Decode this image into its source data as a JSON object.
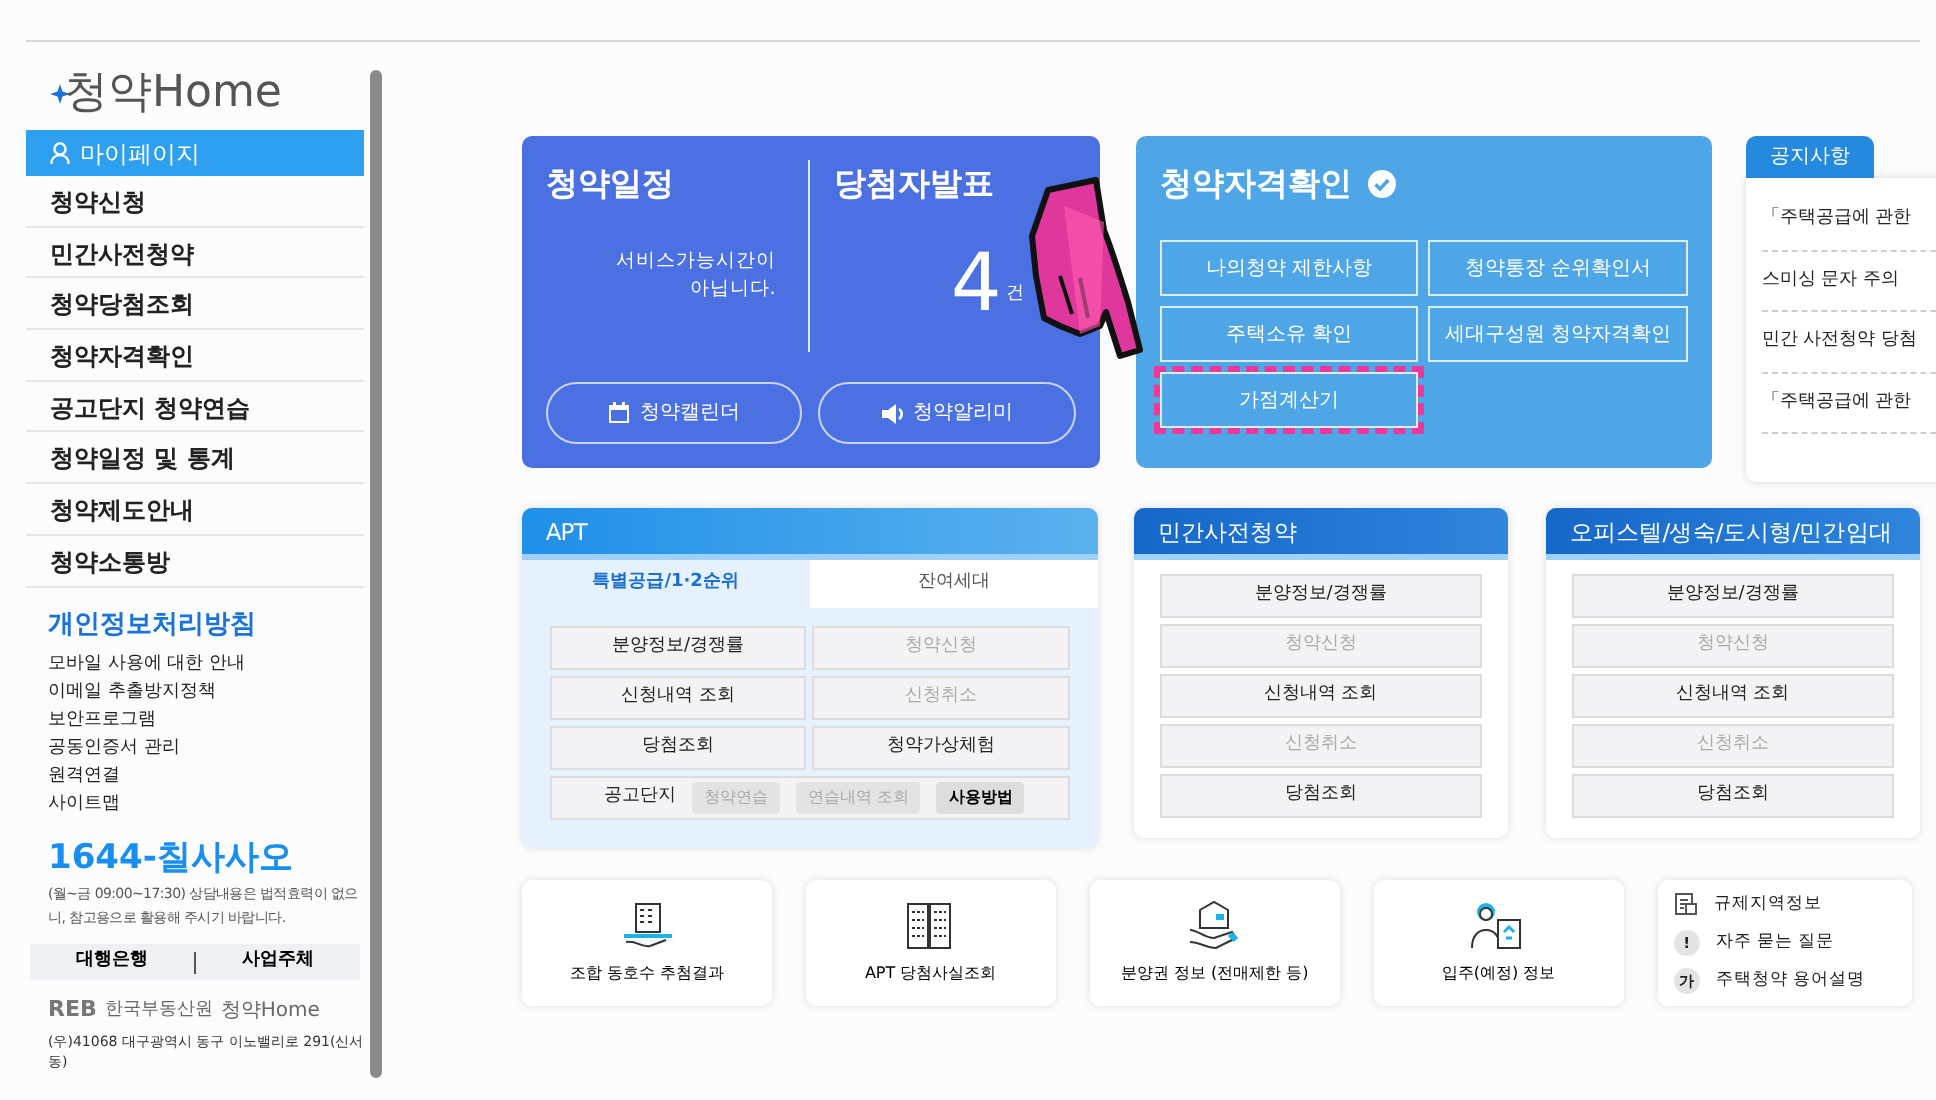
{
  "sidebar": {
    "logo": "청약Home",
    "items": [
      {
        "label": "마이페이지",
        "selected": true,
        "kind": "user"
      },
      {
        "label": "청약신청",
        "selected": false
      },
      {
        "label": "민간사전청약",
        "selected": false
      },
      {
        "label": "청약당첨조회",
        "selected": false
      },
      {
        "label": "청약자격확인",
        "selected": false
      },
      {
        "label": "공고단지 청약연습",
        "selected": false
      },
      {
        "label": "청약일정 및 통계",
        "selected": false
      },
      {
        "label": "청약제도안내",
        "selected": false
      },
      {
        "label": "청약소통방",
        "selected": false
      }
    ],
    "policy_title": "개인정보처리방침",
    "links": [
      "모바일 사용에 대한 안내",
      "이메일 추출방지정책",
      "보안프로그램",
      "공동인증서 관리",
      "원격연결",
      "사이트맵"
    ],
    "phone": "1644-칠사사오",
    "hours_note": "(월~금 09:00~17:30) 상담내용은 법적효력이 없으니, 참고용으로 활용해 주시기 바랍니다.",
    "footer_buttons": [
      "대행은행",
      "사업주체"
    ],
    "footer_logo": {
      "mark": "REB",
      "org": "한국부동산원",
      "site": "청약Home"
    },
    "address": "(우)41068 대구광역시 동구 이노밸리로 291(신서동)"
  },
  "schedule_card": {
    "title": "청약일정",
    "message": "서비스가능시간이 아닙니다.",
    "winners_title": "당첨자발표",
    "count": "4",
    "unit": "건",
    "buttons": [
      {
        "label": "청약캘린더",
        "kind": "calendar"
      },
      {
        "label": "청약알리미",
        "kind": "speaker"
      }
    ]
  },
  "eligibility_card": {
    "title": "청약자격확인",
    "buttons": [
      {
        "label": "나의청약 제한사항",
        "highlighted": false
      },
      {
        "label": "청약통장 순위확인서",
        "highlighted": false
      },
      {
        "label": "주택소유 확인",
        "highlighted": false
      },
      {
        "label": "세대구성원 청약자격확인",
        "highlighted": false
      },
      {
        "label": "가점계산기",
        "highlighted": true
      }
    ]
  },
  "notice": {
    "title": "공지사항",
    "items": [
      "「주택공급에 관한",
      "스미싱 문자 주의",
      "민간 사전청약 당첨",
      "「주택공급에 관한"
    ]
  },
  "apt_panel": {
    "title": "APT",
    "tabs": [
      {
        "label": "특별공급/1·2순위",
        "selected": true
      },
      {
        "label": "잔여세대",
        "selected": false
      }
    ],
    "buttons": [
      {
        "label": "분양정보/경쟁률",
        "disabled": false
      },
      {
        "label": "청약신청",
        "disabled": true
      },
      {
        "label": "신청내역 조회",
        "disabled": false
      },
      {
        "label": "신청취소",
        "disabled": true
      },
      {
        "label": "당첨조회",
        "disabled": false
      },
      {
        "label": "청약가상체험",
        "disabled": false
      }
    ],
    "practice_label": "공고단지",
    "practice_buttons": [
      {
        "label": "청약연습",
        "disabled": true
      },
      {
        "label": "연습내역 조회",
        "disabled": true
      },
      {
        "label": "사용방법",
        "disabled": false
      }
    ]
  },
  "side_panels": [
    {
      "title": "민간사전청약",
      "buttons": [
        {
          "label": "분양정보/경쟁률",
          "disabled": false
        },
        {
          "label": "청약신청",
          "disabled": true
        },
        {
          "label": "신청내역 조회",
          "disabled": false
        },
        {
          "label": "신청취소",
          "disabled": true
        },
        {
          "label": "당첨조회",
          "disabled": false
        }
      ]
    },
    {
      "title": "오피스텔/생숙/도시형/민간임대",
      "buttons": [
        {
          "label": "분양정보/경쟁률",
          "disabled": false
        },
        {
          "label": "청약신청",
          "disabled": true
        },
        {
          "label": "신청내역 조회",
          "disabled": false
        },
        {
          "label": "신청취소",
          "disabled": true
        },
        {
          "label": "당첨조회",
          "disabled": false
        }
      ]
    }
  ],
  "quick_links": [
    {
      "label": "조합 동호수 추첨결과",
      "kind": "hand-building"
    },
    {
      "label": "APT 당첨사실조회",
      "kind": "towers"
    },
    {
      "label": "분양권 정보 (전매제한 등)",
      "kind": "hand-house"
    },
    {
      "label": "입주(예정) 정보",
      "kind": "person-doc"
    }
  ],
  "info_links": [
    {
      "label": "규제지역정보",
      "kind": "doc"
    },
    {
      "label": "자주 묻는 질문",
      "kind": "char",
      "symbol": "!"
    },
    {
      "label": "주택청약 용어설명",
      "kind": "char",
      "symbol": "가"
    }
  ]
}
